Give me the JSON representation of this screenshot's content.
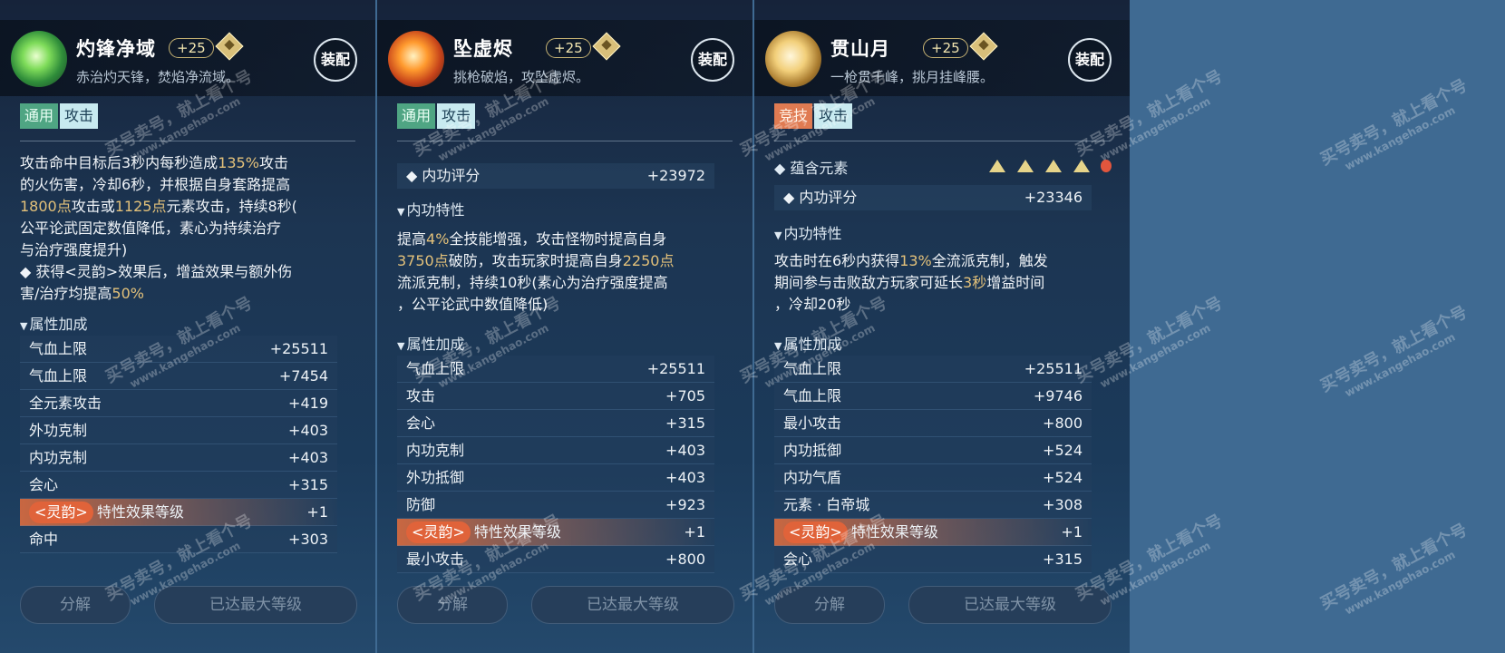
{
  "panels": [
    {
      "name": "灼锋净域",
      "level": "+25",
      "subtitle": "赤治灼天锋，焚焰净流域。",
      "equip_label": "装配",
      "tags": [
        "通用",
        "攻击"
      ],
      "effect_lines": [
        [
          "攻击命中目标后3秒内每秒造成",
          "135%",
          "攻击"
        ],
        [
          "的火伤害，冷却6秒，并根据自身套路提高"
        ],
        [
          "",
          "1800点",
          "攻击或",
          "1125点",
          "元素攻击，持续8秒("
        ],
        [
          "公平论武固定数值降低，素心为持续治疗"
        ],
        [
          "与治疗强度提升)"
        ],
        [
          "◆ 获得<灵韵>效果后，增益效果与额外伤"
        ],
        [
          "害/治疗均提高",
          "50%"
        ]
      ],
      "attr_header": "属性加成",
      "stats": [
        {
          "k": "气血上限",
          "v": "+25511"
        },
        {
          "k": "气血上限",
          "v": "+7454"
        },
        {
          "k": "全元素攻击",
          "v": "+419"
        },
        {
          "k": "外功克制",
          "v": "+403"
        },
        {
          "k": "内功克制",
          "v": "+403"
        },
        {
          "k": "会心",
          "v": "+315"
        },
        {
          "k": "特性效果等级",
          "v": "+1",
          "pill": "<灵韵>"
        },
        {
          "k": "命中",
          "v": "+303"
        }
      ],
      "buttons": {
        "decompose": "分解",
        "maxed": "已达最大等级"
      }
    },
    {
      "name": "坠虚烬",
      "level": "+25",
      "subtitle": "挑枪破焰，攻坠虚烬。",
      "equip_label": "装配",
      "tags": [
        "通用",
        "攻击"
      ],
      "score_label": "内功评分",
      "score_value": "+23972",
      "trait_header": "内功特性",
      "effect_lines": [
        [
          "提高",
          "4%",
          "全技能增强，攻击怪物时提高自身"
        ],
        [
          "",
          "3750点",
          "破防，攻击玩家时提高自身",
          "2250点"
        ],
        [
          "流派克制，持续10秒(素心为治疗强度提高"
        ],
        [
          "，公平论武中数值降低)"
        ]
      ],
      "attr_header": "属性加成",
      "stats": [
        {
          "k": "气血上限",
          "v": "+25511"
        },
        {
          "k": "攻击",
          "v": "+705"
        },
        {
          "k": "会心",
          "v": "+315"
        },
        {
          "k": "内功克制",
          "v": "+403"
        },
        {
          "k": "外功抵御",
          "v": "+403"
        },
        {
          "k": "防御",
          "v": "+923"
        },
        {
          "k": "特性效果等级",
          "v": "+1",
          "pill": "<灵韵>"
        },
        {
          "k": "最小攻击",
          "v": "+800"
        }
      ],
      "buttons": {
        "decompose": "分解",
        "maxed": "已达最大等级"
      }
    },
    {
      "name": "贯山月",
      "level": "+25",
      "subtitle": "一枪贯千峰，挑月挂峰腰。",
      "equip_label": "装配",
      "tags": [
        "竞技",
        "攻击"
      ],
      "element_label": "蕴含元素",
      "score_label": "内功评分",
      "score_value": "+23346",
      "trait_header": "内功特性",
      "effect_lines": [
        [
          "攻击时在6秒内获得",
          "13%",
          "全流派克制，触发"
        ],
        [
          "期间参与击败敌方玩家可延长",
          "3秒",
          "增益时间"
        ],
        [
          "，冷却20秒"
        ]
      ],
      "attr_header": "属性加成",
      "stats": [
        {
          "k": "气血上限",
          "v": "+25511"
        },
        {
          "k": "气血上限",
          "v": "+9746"
        },
        {
          "k": "最小攻击",
          "v": "+800"
        },
        {
          "k": "内功抵御",
          "v": "+524"
        },
        {
          "k": "内功气盾",
          "v": "+524"
        },
        {
          "k": "元素 · 白帝城",
          "v": "+308"
        },
        {
          "k": "特性效果等级",
          "v": "+1",
          "pill": "<灵韵>"
        },
        {
          "k": "会心",
          "v": "+315"
        }
      ],
      "buttons": {
        "decompose": "分解",
        "maxed": "已达最大等级"
      }
    }
  ],
  "watermark": {
    "line1": "买号卖号，就上看个号",
    "line2": "www.kangehao.com"
  }
}
